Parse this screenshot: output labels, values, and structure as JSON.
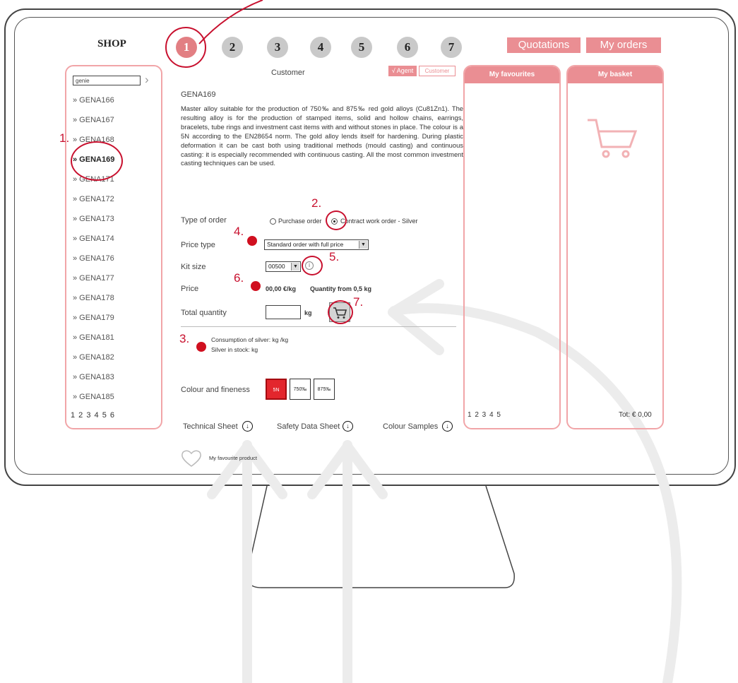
{
  "app": {
    "title": "SHOP"
  },
  "steps": [
    {
      "label": "1",
      "active": true
    },
    {
      "label": "2",
      "active": false
    },
    {
      "label": "3",
      "active": false
    },
    {
      "label": "4",
      "active": false
    },
    {
      "label": "5",
      "active": false
    },
    {
      "label": "6",
      "active": false
    },
    {
      "label": "7",
      "active": false
    }
  ],
  "top_buttons": {
    "quotations": "Quotations",
    "my_orders": "My orders"
  },
  "sidebar": {
    "search_value": "genie",
    "items": [
      "» GENA166",
      "» GENA167",
      "» GENA168",
      "» GENA169",
      "» GENA171",
      "» GENA172",
      "» GENA173",
      "» GENA174",
      "» GENA176",
      "» GENA177",
      "» GENA178",
      "» GENA179",
      "» GENA181",
      "» GENA182",
      "» GENA183",
      "» GENA185"
    ],
    "selected": "» GENA169",
    "pager": "1 2 3 4 5 6"
  },
  "header": {
    "customer_label": "Customer",
    "agent_tag": "√ Agent",
    "customer_tag": "Customer"
  },
  "product": {
    "code": "GENA169",
    "description": "Master alloy suitable for the production of 750‰ and 875‰ red gold alloys (Cu81Zn1). The resulting alloy is for the production of stamped items, solid and hollow chains, earrings, bracelets, tube rings and investment cast items with and without stones in place. The colour is a 5N according to the EN28654 norm. The gold alloy lends itself for hardening. During plastic deformation it can be cast both using traditional methods (mould casting) and continuous casting: it is especially recommended with continuous casting. All the most common investment casting techniques can be used."
  },
  "form": {
    "type_of_order": {
      "label": "Type of order",
      "option1": "Purchase order",
      "option2": "Contract work order - Silver"
    },
    "price_type": {
      "label": "Price type",
      "value": "Standard order with full price"
    },
    "kit_size": {
      "label": "Kit size",
      "value": "00500"
    },
    "price": {
      "label": "Price",
      "value": "00,00 €/kg",
      "quantity_note": "Quantity from 0,5 kg"
    },
    "total_quantity": {
      "label": "Total quantity",
      "unit": "kg"
    },
    "silver": {
      "consumption": "Consumption of silver: kg /kg",
      "stock": "Silver in stock: kg"
    },
    "colour": {
      "label": "Colour and fineness",
      "swatches": [
        "5N",
        "750‰",
        "875‰"
      ]
    }
  },
  "downloads": {
    "technical_sheet": "Technical Sheet",
    "safety_sheet": "Safety Data Sheet",
    "colour_samples": "Colour Samples"
  },
  "favourite": {
    "label": "My favourite product"
  },
  "favourites_panel": {
    "title": "My favourites",
    "pager": "1 2 3 4 5"
  },
  "basket_panel": {
    "title": "My basket",
    "total": "Tot: € 0,00"
  },
  "annotations": [
    "1.",
    "2.",
    "3.",
    "4.",
    "5.",
    "6.",
    "7."
  ],
  "colors": {
    "accent": "#ea8e93",
    "annotation_red": "#c8102e"
  }
}
